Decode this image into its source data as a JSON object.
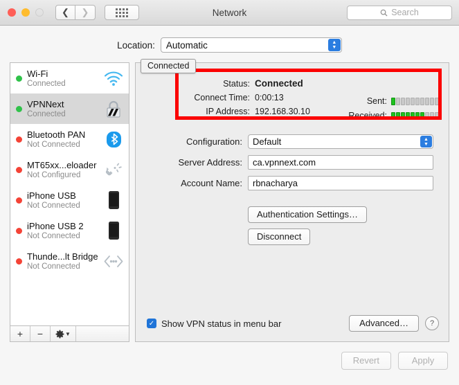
{
  "window": {
    "title": "Network",
    "back_icon": "chevron-left-icon",
    "forward_icon": "chevron-right-icon",
    "grid_icon": "show-all-grid-icon"
  },
  "search": {
    "placeholder": "Search",
    "icon": "search-icon",
    "value": ""
  },
  "location": {
    "label": "Location:",
    "value": "Automatic"
  },
  "sidebar": {
    "services": [
      {
        "name": "Wi-Fi",
        "state": "Connected",
        "status_color": "green",
        "icon": "wifi-icon",
        "selected": false
      },
      {
        "name": "VPNNext",
        "state": "Connected",
        "status_color": "green",
        "icon": "lock-icon",
        "selected": true
      },
      {
        "name": "Bluetooth PAN",
        "state": "Not Connected",
        "status_color": "red",
        "icon": "bluetooth-icon",
        "selected": false
      },
      {
        "name": "MT65xx...eloader",
        "state": "Not Configured",
        "status_color": "red",
        "icon": "modem-phone-icon",
        "selected": false
      },
      {
        "name": "iPhone USB",
        "state": "Not Connected",
        "status_color": "red",
        "icon": "iphone-icon",
        "selected": false
      },
      {
        "name": "iPhone USB 2",
        "state": "Not Connected",
        "status_color": "red",
        "icon": "iphone-icon",
        "selected": false
      },
      {
        "name": "Thunde...lt Bridge",
        "state": "Not Connected",
        "status_color": "red",
        "icon": "thunderbolt-bridge-icon",
        "selected": false
      }
    ],
    "footer": {
      "add_label": "+",
      "remove_label": "−",
      "gear_icon": "gear-icon",
      "gear_chevron": "chevron-down-icon"
    }
  },
  "tooltip": {
    "text": "Connected"
  },
  "status": {
    "status_label": "Status:",
    "status_value": "Connected",
    "connect_time_label": "Connect Time:",
    "connect_time_value": "0:00:13",
    "ip_address_label": "IP Address:",
    "ip_address_value": "192.168.30.10",
    "sent_label": "Sent:",
    "received_label": "Received:",
    "sent_bars_total": 10,
    "sent_bars_active": 1,
    "received_bars_total": 10,
    "received_bars_active": 7,
    "bar_active_color": "#1fc21f",
    "bar_inactive_color": "#c9c9c9",
    "highlight_color": "#fb0000"
  },
  "form": {
    "configuration_label": "Configuration:",
    "configuration_value": "Default",
    "server_address_label": "Server Address:",
    "server_address_value": "ca.vpnnext.com",
    "account_name_label": "Account Name:",
    "account_name_value": "rbnacharya"
  },
  "actions": {
    "auth_settings_label": "Authentication Settings…",
    "disconnect_label": "Disconnect"
  },
  "bottom": {
    "show_status_label": "Show VPN status in menu bar",
    "show_status_checked": true,
    "check_glyph": "✓",
    "advanced_label": "Advanced…",
    "help_label": "?"
  },
  "footer": {
    "revert_label": "Revert",
    "apply_label": "Apply"
  }
}
